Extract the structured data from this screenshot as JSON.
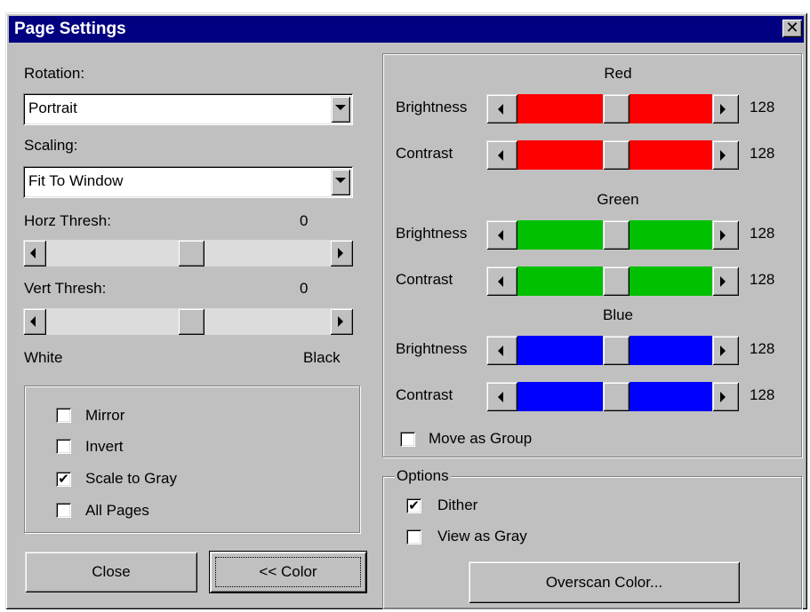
{
  "window": {
    "title": "Page Settings",
    "close_glyph": "✕"
  },
  "left": {
    "rotation": {
      "label": "Rotation:",
      "value": "Portrait"
    },
    "scaling": {
      "label": "Scaling:",
      "value": "Fit To Window"
    },
    "horz_thresh": {
      "label": "Horz Thresh:",
      "value": "0",
      "position": 0.5
    },
    "vert_thresh": {
      "label": "Vert Thresh:",
      "value": "0",
      "position": 0.5
    },
    "range_min_label": "White",
    "range_max_label": "Black",
    "checkboxes": [
      {
        "label": "Mirror",
        "checked": false
      },
      {
        "label": "Invert",
        "checked": false
      },
      {
        "label": "Scale to Gray",
        "checked": true
      },
      {
        "label": "All Pages",
        "checked": false
      }
    ],
    "close_button": "Close",
    "color_button": "<< Color"
  },
  "color": {
    "groups": [
      {
        "name": "Red",
        "color": "#ff0000",
        "brightness": {
          "label": "Brightness",
          "value": "128"
        },
        "contrast": {
          "label": "Contrast",
          "value": "128"
        }
      },
      {
        "name": "Green",
        "color": "#00c000",
        "brightness": {
          "label": "Brightness",
          "value": "128"
        },
        "contrast": {
          "label": "Contrast",
          "value": "128"
        }
      },
      {
        "name": "Blue",
        "color": "#0000ff",
        "brightness": {
          "label": "Brightness",
          "value": "128"
        },
        "contrast": {
          "label": "Contrast",
          "value": "128"
        }
      }
    ],
    "move_as_group": {
      "label": "Move as Group",
      "checked": false
    }
  },
  "options": {
    "title": "Options",
    "dither": {
      "label": "Dither",
      "checked": true
    },
    "view_as_gray": {
      "label": "View as Gray",
      "checked": false
    },
    "overscan_button": "Overscan Color..."
  }
}
